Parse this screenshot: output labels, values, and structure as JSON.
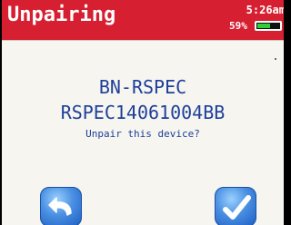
{
  "header": {
    "title": "Unpairing",
    "time": "5:26am",
    "battery_percent_label": "59%",
    "battery_level": 0.59
  },
  "device": {
    "model": "BN-RSPEC",
    "serial": "RSPEC14061004BB"
  },
  "dialog": {
    "prompt": "Unpair this device?"
  },
  "icons": {
    "back": "back-arrow-icon",
    "confirm": "checkmark-icon",
    "battery": "battery-icon"
  },
  "colors": {
    "header_bg": "#d61f30",
    "text_blue": "#1f3f9a",
    "battery_fill": "#2fce3a",
    "button_blue": "#4a90e2"
  }
}
